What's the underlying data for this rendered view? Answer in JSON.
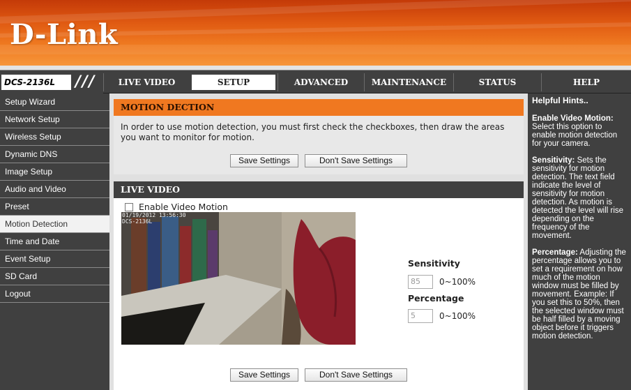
{
  "brand": {
    "logo": "D-Link",
    "model": "DCS-2136L"
  },
  "nav": {
    "tabs": [
      {
        "label": "LIVE VIDEO"
      },
      {
        "label": "SETUP"
      },
      {
        "label": "ADVANCED"
      },
      {
        "label": "MAINTENANCE"
      },
      {
        "label": "STATUS"
      },
      {
        "label": "HELP"
      }
    ],
    "active_tab": "SETUP"
  },
  "sidebar": {
    "items": [
      {
        "label": "Setup Wizard"
      },
      {
        "label": "Network Setup"
      },
      {
        "label": "Wireless Setup"
      },
      {
        "label": "Dynamic DNS"
      },
      {
        "label": "Image Setup"
      },
      {
        "label": "Audio and Video"
      },
      {
        "label": "Preset"
      },
      {
        "label": "Motion Detection"
      },
      {
        "label": "Time and Date"
      },
      {
        "label": "Event Setup"
      },
      {
        "label": "SD Card"
      },
      {
        "label": "Logout"
      }
    ],
    "active_item": "Motion Detection"
  },
  "motion": {
    "title": "MOTION DECTION",
    "description": "In order to use motion detection, you must first check the checkboxes, then draw the areas you want to monitor for motion.",
    "save_label": "Save Settings",
    "dont_save_label": "Don't Save Settings"
  },
  "live": {
    "title": "LIVE VIDEO",
    "enable_label": "Enable Video Motion",
    "enable_checked": false,
    "video_overlay": "01/19/2012 13:56:30\nDCS-2136L",
    "sensitivity_label": "Sensitivity",
    "sensitivity_value": "85",
    "sensitivity_range": "0~100%",
    "percentage_label": "Percentage",
    "percentage_value": "5",
    "percentage_range": "0~100%"
  },
  "bottom": {
    "save_label": "Save Settings",
    "dont_save_label": "Don't Save Settings"
  },
  "hints": {
    "title": "Helpful Hints..",
    "items": [
      {
        "term": "Enable Video Motion:",
        "text": "Select this option to enable motion detection for your camera."
      },
      {
        "term": "Sensitivity:",
        "text": "Sets the sensitivity for motion detection. The text field indicate the level of sensitivity for motion detection. As motion is detected the level will rise depending on the frequency of the movement."
      },
      {
        "term": "Percentage:",
        "text": "Adjusting the percentage allows you to set a requirement on how much of the motion window must be filled by movement. Example: If you set this to 50%, then the selected window must be half filled by a moving object before it triggers motion detection."
      }
    ]
  },
  "colors": {
    "header_orange": "#f07c22",
    "section_orange": "#f07820",
    "nav_dark": "#404040"
  }
}
